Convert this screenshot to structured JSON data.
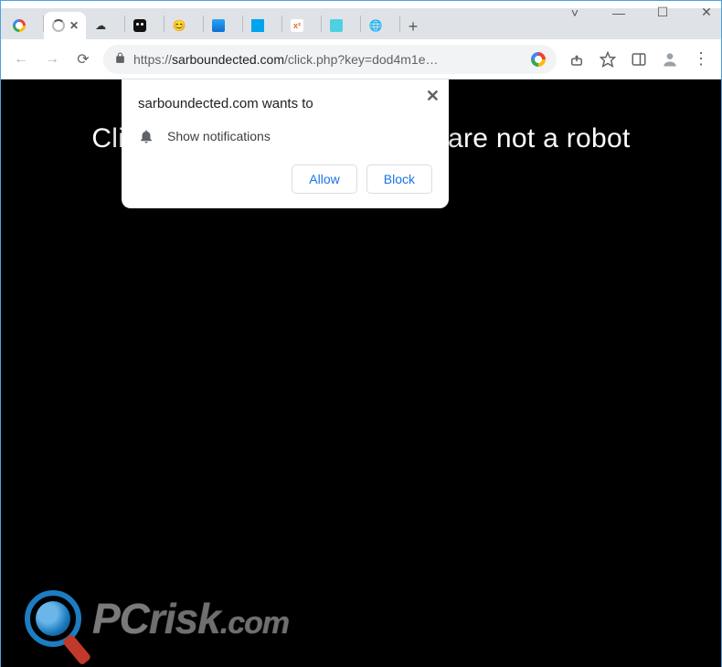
{
  "window": {
    "chevron": "˅",
    "min": "—",
    "max": "☐",
    "close": "✕"
  },
  "tabs": [
    {
      "glyph": ""
    },
    {
      "glyph": "C"
    },
    {
      "glyph": ""
    },
    {
      "glyph": ""
    },
    {
      "glyph": "😊"
    },
    {
      "glyph": ""
    },
    {
      "glyph": ""
    },
    {
      "glyph": "x²"
    },
    {
      "glyph": ""
    },
    {
      "glyph": "🌐"
    }
  ],
  "newtab_label": "+",
  "toolbar": {
    "back": "←",
    "forward": "→",
    "reload": "⟳",
    "url_scheme": "https://",
    "url_host": "sarboundected.com",
    "url_path": "/click.php?key=dod4m1e…",
    "share": "↗",
    "star": "☆",
    "exttab": "▢",
    "menu": "⋮"
  },
  "prompt": {
    "title": "sarboundected.com wants to",
    "line": "Show notifications",
    "allow": "Allow",
    "block": "Block",
    "close": "✕"
  },
  "page": {
    "headline_left": "Cli",
    "headline_right": "u are not a robot",
    "watermark_text1": "PC",
    "watermark_text2": "risk",
    "watermark_text3": ".com"
  }
}
